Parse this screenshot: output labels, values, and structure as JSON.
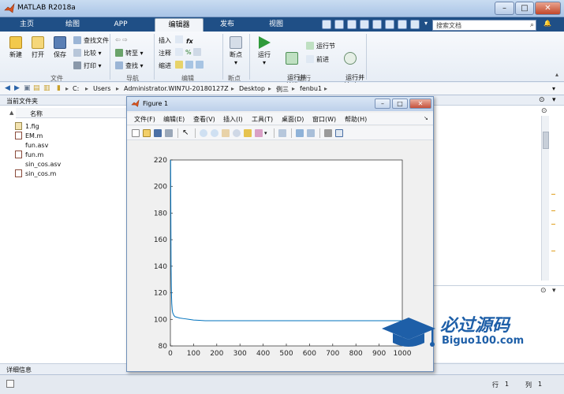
{
  "window": {
    "title": "MATLAB R2018a"
  },
  "tabs": [
    {
      "label": "主页",
      "active": false
    },
    {
      "label": "绘图",
      "active": false
    },
    {
      "label": "APP",
      "active": false
    },
    {
      "label": "编辑器",
      "active": true
    },
    {
      "label": "发布",
      "active": false
    },
    {
      "label": "视图",
      "active": false
    }
  ],
  "search": {
    "placeholder": "搜索文档"
  },
  "ribbon": {
    "file_group": {
      "label": "文件",
      "new": "新建",
      "open": "打开",
      "save": "保存",
      "find_file": "查找文件",
      "compare": "比较",
      "print": "打印"
    },
    "nav_group": {
      "label": "导航",
      "goto": "转至",
      "find": "查找"
    },
    "edit_group": {
      "label": "编辑",
      "insert": "插入",
      "comment": "注释",
      "indent": "缩进",
      "fx": "fx"
    },
    "breakpoint_group": {
      "label": "断点",
      "breakpoint": "断点"
    },
    "run_group": {
      "label": "运行",
      "run": "运行",
      "run_advance": "运行并\n前进",
      "run_section": "运行节",
      "advance": "前进",
      "run_time": "运行并\n计时"
    }
  },
  "address": {
    "crumbs": [
      "C:",
      "Users",
      "Administrator.WIN7U-20180127Z",
      "Desktop",
      "例三",
      "fenbu1"
    ]
  },
  "current_folder": {
    "title": "当前文件夹",
    "column": "名称",
    "files": [
      {
        "name": "1.fig",
        "icon": "fig-file-icon"
      },
      {
        "name": "EM.m",
        "icon": "m-file-icon"
      },
      {
        "name": "fun.asv",
        "icon": "asv-file-icon"
      },
      {
        "name": "fun.m",
        "icon": "m-file-icon"
      },
      {
        "name": "sin_cos.asv",
        "icon": "asv-file-icon"
      },
      {
        "name": "sin_cos.m",
        "icon": "m-file-icon"
      }
    ]
  },
  "detail_label": "详细信息",
  "status": {
    "row_label": "行",
    "row": "1",
    "col_label": "列",
    "col": "1"
  },
  "figure": {
    "title": "Figure 1",
    "menus": [
      "文件(F)",
      "编辑(E)",
      "查看(V)",
      "插入(I)",
      "工具(T)",
      "桌面(D)",
      "窗口(W)",
      "帮助(H)"
    ]
  },
  "watermark": {
    "cn": "必过源码",
    "en": "Biguo100.com"
  },
  "colors": {
    "accent": "#1f4f86",
    "line": "#0072bd",
    "watermark": "#1e5fa8"
  },
  "chart_data": {
    "type": "line",
    "title": "",
    "xlabel": "",
    "ylabel": "",
    "xlim": [
      0,
      1000
    ],
    "ylim": [
      80,
      220
    ],
    "xticks": [
      0,
      100,
      200,
      300,
      400,
      500,
      600,
      700,
      800,
      900,
      1000
    ],
    "yticks": [
      80,
      100,
      120,
      140,
      160,
      180,
      200,
      220
    ],
    "grid": false,
    "series": [
      {
        "x": [
          1,
          2,
          3,
          4,
          5,
          6,
          8,
          10,
          15,
          20,
          30,
          40,
          60,
          80,
          100,
          150,
          200,
          300,
          400,
          500,
          600,
          700,
          800,
          900,
          1000
        ],
        "y": [
          220,
          180,
          140,
          125,
          117,
          112,
          107,
          105,
          103,
          102,
          101.5,
          101,
          100.5,
          100,
          99.5,
          99,
          99,
          99,
          99,
          99,
          99,
          99,
          99,
          99,
          99
        ]
      }
    ]
  }
}
